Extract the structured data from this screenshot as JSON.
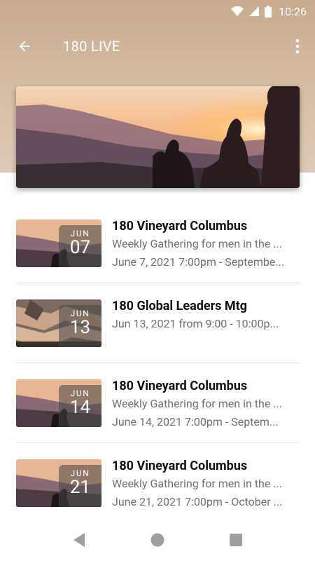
{
  "status_bar": {
    "time": "10:26",
    "icons": [
      "wifi-icon",
      "signal-icon",
      "battery-icon"
    ]
  },
  "app_bar": {
    "title": "180 LIVE",
    "back_icon": "arrow-back-icon",
    "menu_icon": "more-vert-icon"
  },
  "events": [
    {
      "month": "JUN",
      "day": "07",
      "title": "180 Vineyard Columbus",
      "line1": "Weekly Gathering for men in the ...",
      "line2": "June 7, 2021 7:00pm - Septembe...",
      "image": "sunset-hikers"
    },
    {
      "month": "JUN",
      "day": "13",
      "title": "180 Global Leaders Mtg",
      "line1": "Jun 13, 2021 from 9:00 - 10:00p...",
      "line2": "",
      "image": "hands-together"
    },
    {
      "month": "JUN",
      "day": "14",
      "title": "180 Vineyard Columbus",
      "line1": "Weekly Gathering for men in the ...",
      "line2": "June 14, 2021 7:00pm - Septem...",
      "image": "sunset-hikers"
    },
    {
      "month": "JUN",
      "day": "21",
      "title": "180 Vineyard Columbus",
      "line1": "Weekly Gathering for men in the ...",
      "line2": "June 21, 2021 7:00pm - October ...",
      "image": "sunset-hikers"
    }
  ],
  "nav_bar": {
    "icons": [
      "back-triangle-icon",
      "home-circle-icon",
      "recents-square-icon"
    ]
  },
  "colors": {
    "header": "#c8ab8f",
    "title": "#111111",
    "subtitle": "#707070",
    "divider": "#e4e4e4"
  }
}
